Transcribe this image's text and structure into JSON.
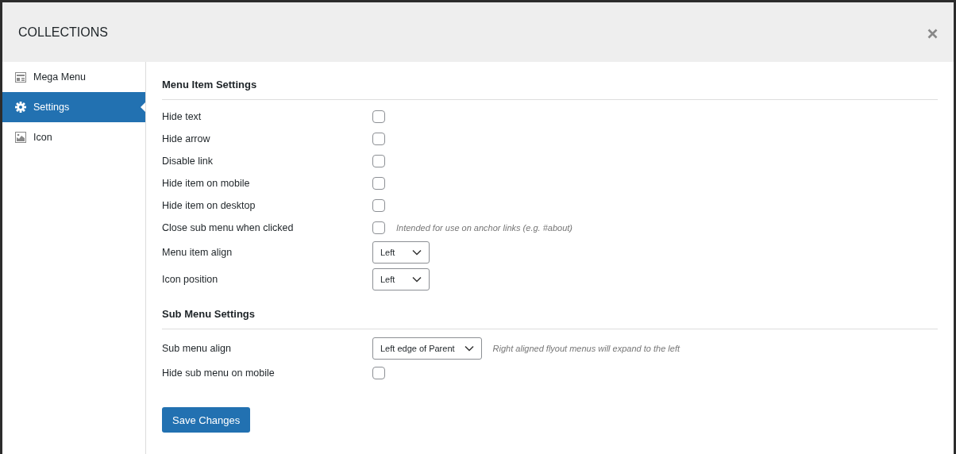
{
  "window": {
    "title": "COLLECTIONS"
  },
  "sidebar": {
    "items": [
      {
        "label": "Mega Menu",
        "selected": false
      },
      {
        "label": "Settings",
        "selected": true
      },
      {
        "label": "Icon",
        "selected": false
      }
    ]
  },
  "sections": [
    {
      "title": "Menu Item Settings",
      "rows": [
        {
          "kind": "checkbox",
          "label": "Hide text",
          "checked": false
        },
        {
          "kind": "checkbox",
          "label": "Hide arrow",
          "checked": false
        },
        {
          "kind": "checkbox",
          "label": "Disable link",
          "checked": false
        },
        {
          "kind": "checkbox",
          "label": "Hide item on mobile",
          "checked": false
        },
        {
          "kind": "checkbox",
          "label": "Hide item on desktop",
          "checked": false
        },
        {
          "kind": "checkbox",
          "label": "Close sub menu when clicked",
          "checked": false,
          "hint": "Intended for use on anchor links (e.g. #about)"
        },
        {
          "kind": "select",
          "label": "Menu item align",
          "value": "Left"
        },
        {
          "kind": "select",
          "label": "Icon position",
          "value": "Left"
        }
      ]
    },
    {
      "title": "Sub Menu Settings",
      "rows": [
        {
          "kind": "select",
          "label": "Sub menu align",
          "value": "Left edge of Parent",
          "hint": "Right aligned flyout menus will expand to the left"
        },
        {
          "kind": "checkbox",
          "label": "Hide sub menu on mobile",
          "checked": false
        }
      ]
    }
  ],
  "save_button": "Save Changes"
}
